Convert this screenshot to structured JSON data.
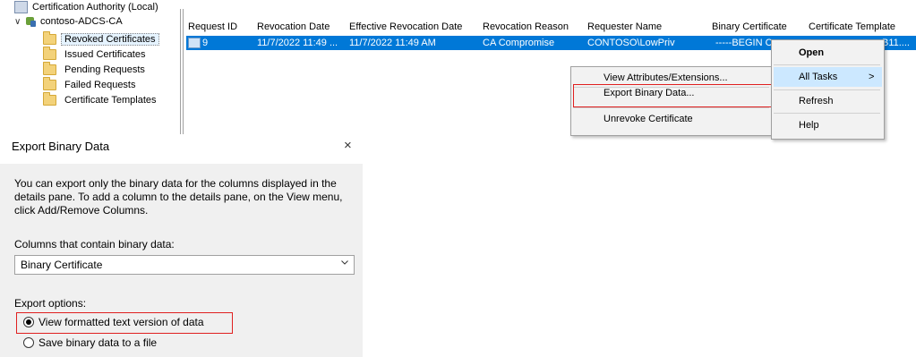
{
  "tree": {
    "root_label": "Certification Authority (Local)",
    "ca_label": "contoso-ADCS-CA",
    "items": [
      {
        "label": "Revoked Certificates",
        "selected": true
      },
      {
        "label": "Issued Certificates"
      },
      {
        "label": "Pending Requests"
      },
      {
        "label": "Failed Requests"
      },
      {
        "label": "Certificate Templates"
      }
    ]
  },
  "list": {
    "columns": [
      "Request ID",
      "Revocation Date",
      "Effective Revocation Date",
      "Revocation Reason",
      "Requester Name",
      "Binary Certificate",
      "Certificate Template"
    ],
    "row": {
      "request_id": "9",
      "revocation_date": "11/7/2022 11:49 ...",
      "effective_revocation_date": "11/7/2022 11:49 AM",
      "revocation_reason": "CA Compromise",
      "requester_name": "CONTOSO\\LowPriv",
      "binary_certificate": "-----BEGIN C",
      "certificate_template": "B11...."
    }
  },
  "context_menu": {
    "items": [
      "Open",
      "All Tasks",
      "Refresh",
      "Help"
    ],
    "submenu_arrow": ">"
  },
  "submenu": {
    "items": [
      "View Attributes/Extensions...",
      "Export Binary Data...",
      "Unrevoke Certificate"
    ]
  },
  "dialog": {
    "title": "Export Binary Data",
    "close_glyph": "×",
    "description": "You can export only the binary data for the columns displayed in the details pane. To add a column to the details pane, on the View menu, click Add/Remove Columns.",
    "columns_label": "Columns that contain binary data:",
    "columns_value": "Binary Certificate",
    "export_options_label": "Export options:",
    "option_view": "View formatted text version of data",
    "option_save": "Save binary data to a file"
  },
  "colors": {
    "selection": "#0078d7",
    "highlight_box": "#e02020",
    "menu_hover": "#cce8ff",
    "dialog_bg": "#f0f0f0"
  }
}
